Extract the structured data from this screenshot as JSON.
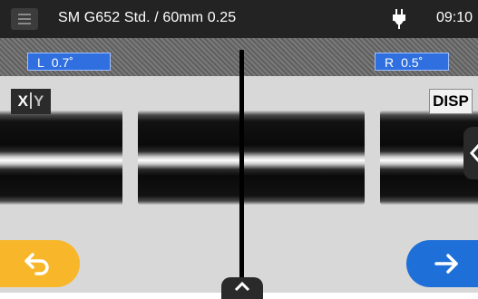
{
  "status_bar": {
    "title": "SM G652 Std. / 60mm 0.25",
    "time": "09:10",
    "power_icon": "plug-icon"
  },
  "angles": {
    "left": {
      "label": "L",
      "value": "0.7˚"
    },
    "right": {
      "label": "R",
      "value": "0.5˚"
    }
  },
  "view": {
    "xy_button": {
      "x": "X",
      "y": "Y"
    },
    "disp_label": "DISP",
    "side_tab_icon": "chevron-left-icon",
    "bottom_tab_icon": "chevron-up-icon"
  },
  "nav": {
    "back_icon": "back-arrow-icon",
    "next_icon": "next-arrow-icon"
  },
  "colors": {
    "status_bar_bg": "#232323",
    "angle_box_bg": "#2f6fdf",
    "back_button": "#f8b72a",
    "next_button": "#1f6fd8"
  }
}
